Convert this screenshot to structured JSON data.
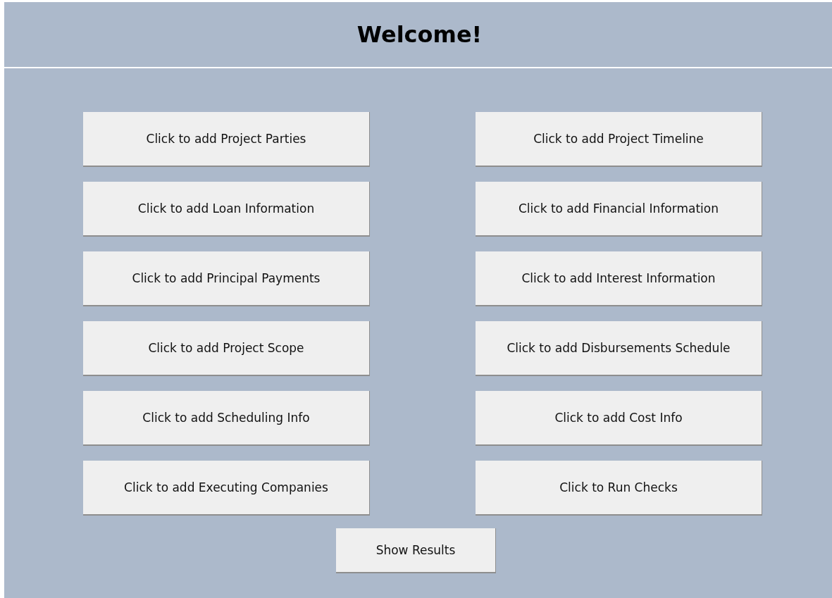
{
  "title": "Welcome!",
  "buttons": [
    {
      "label": "Click to add Project Parties"
    },
    {
      "label": "Click to add Project Timeline"
    },
    {
      "label": "Click to add Loan Information"
    },
    {
      "label": "Click to add Financial Information"
    },
    {
      "label": "Click to add Principal Payments"
    },
    {
      "label": "Click to add Interest Information"
    },
    {
      "label": "Click to add Project Scope"
    },
    {
      "label": "Click to add Disbursements Schedule"
    },
    {
      "label": "Click to add Scheduling Info"
    },
    {
      "label": "Click to add Cost Info"
    },
    {
      "label": "Click to add Executing Companies"
    },
    {
      "label": "Click to Run Checks"
    }
  ],
  "footer_button": {
    "label": "Show Results"
  }
}
